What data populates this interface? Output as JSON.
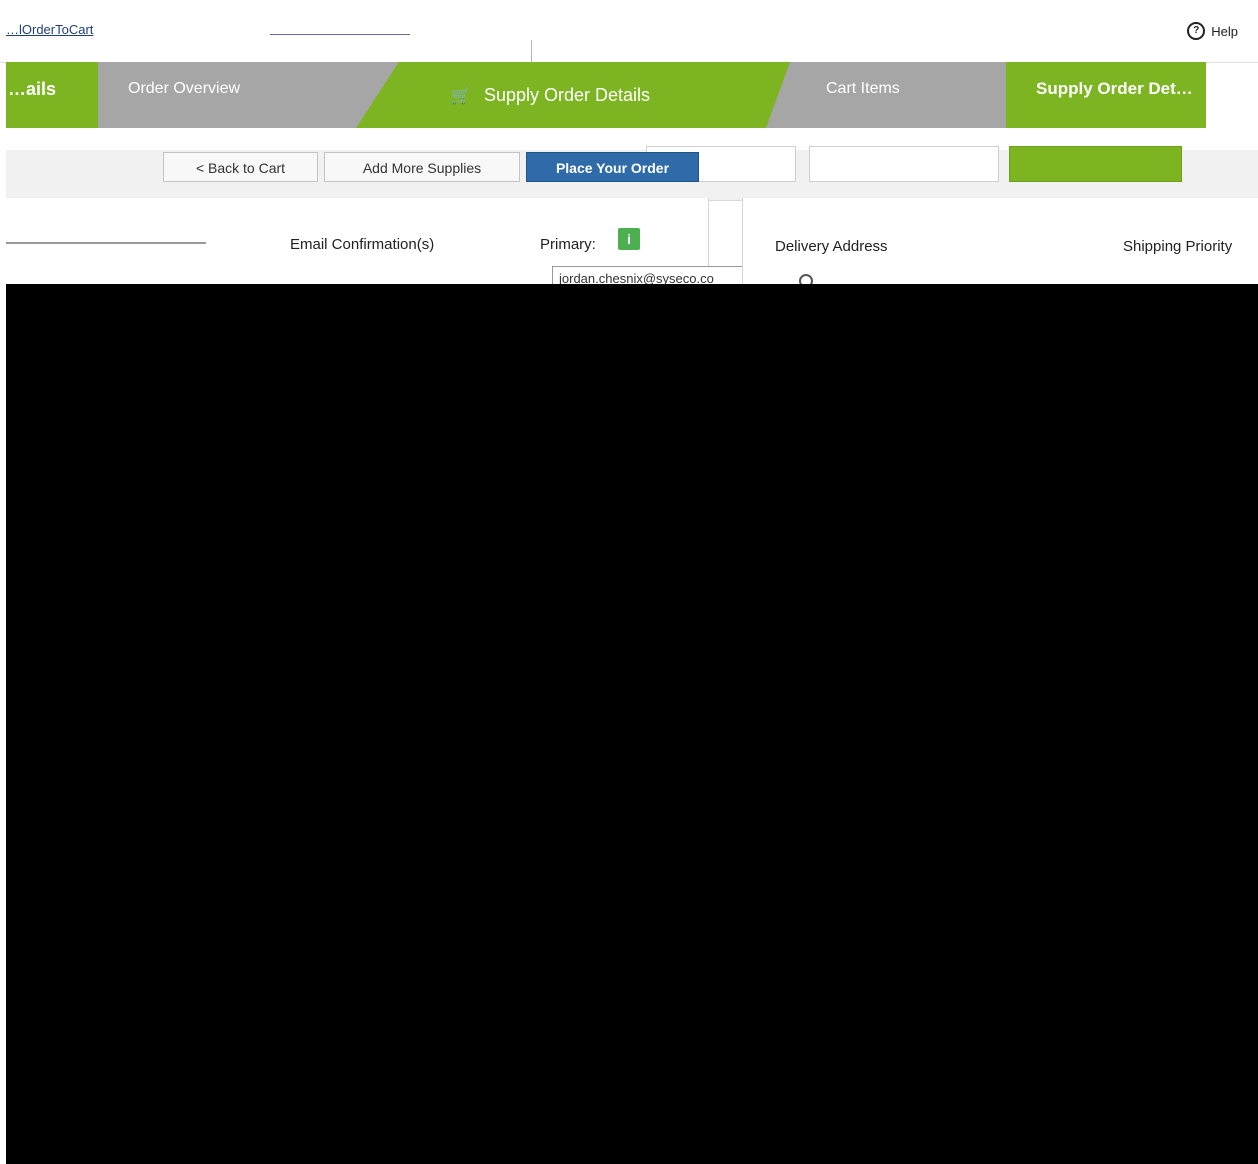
{
  "topbar": {
    "link": "…lOrderToCart",
    "help_label": "Help"
  },
  "steps": [
    {
      "label": "…ails"
    },
    {
      "label": "Order Overview"
    },
    {
      "label": "Supply Order Details"
    },
    {
      "label": "Cart Items"
    },
    {
      "label": "Supply Order Det…"
    }
  ],
  "buttons": {
    "back": "< Back to Cart",
    "add_more": "Add More Supplies",
    "place_order": "Place Your Order"
  },
  "left_panel": {
    "email_label": "Email Confirmation(s)",
    "primary_label": "Primary:",
    "email_value": "jordan.chesnix@syseco.co"
  },
  "right_panel": {
    "delivery_label": "Delivery Address",
    "shipping_label": "Shipping Priority"
  },
  "icons": {
    "info": "i",
    "help": "?",
    "cart": "🛒"
  }
}
